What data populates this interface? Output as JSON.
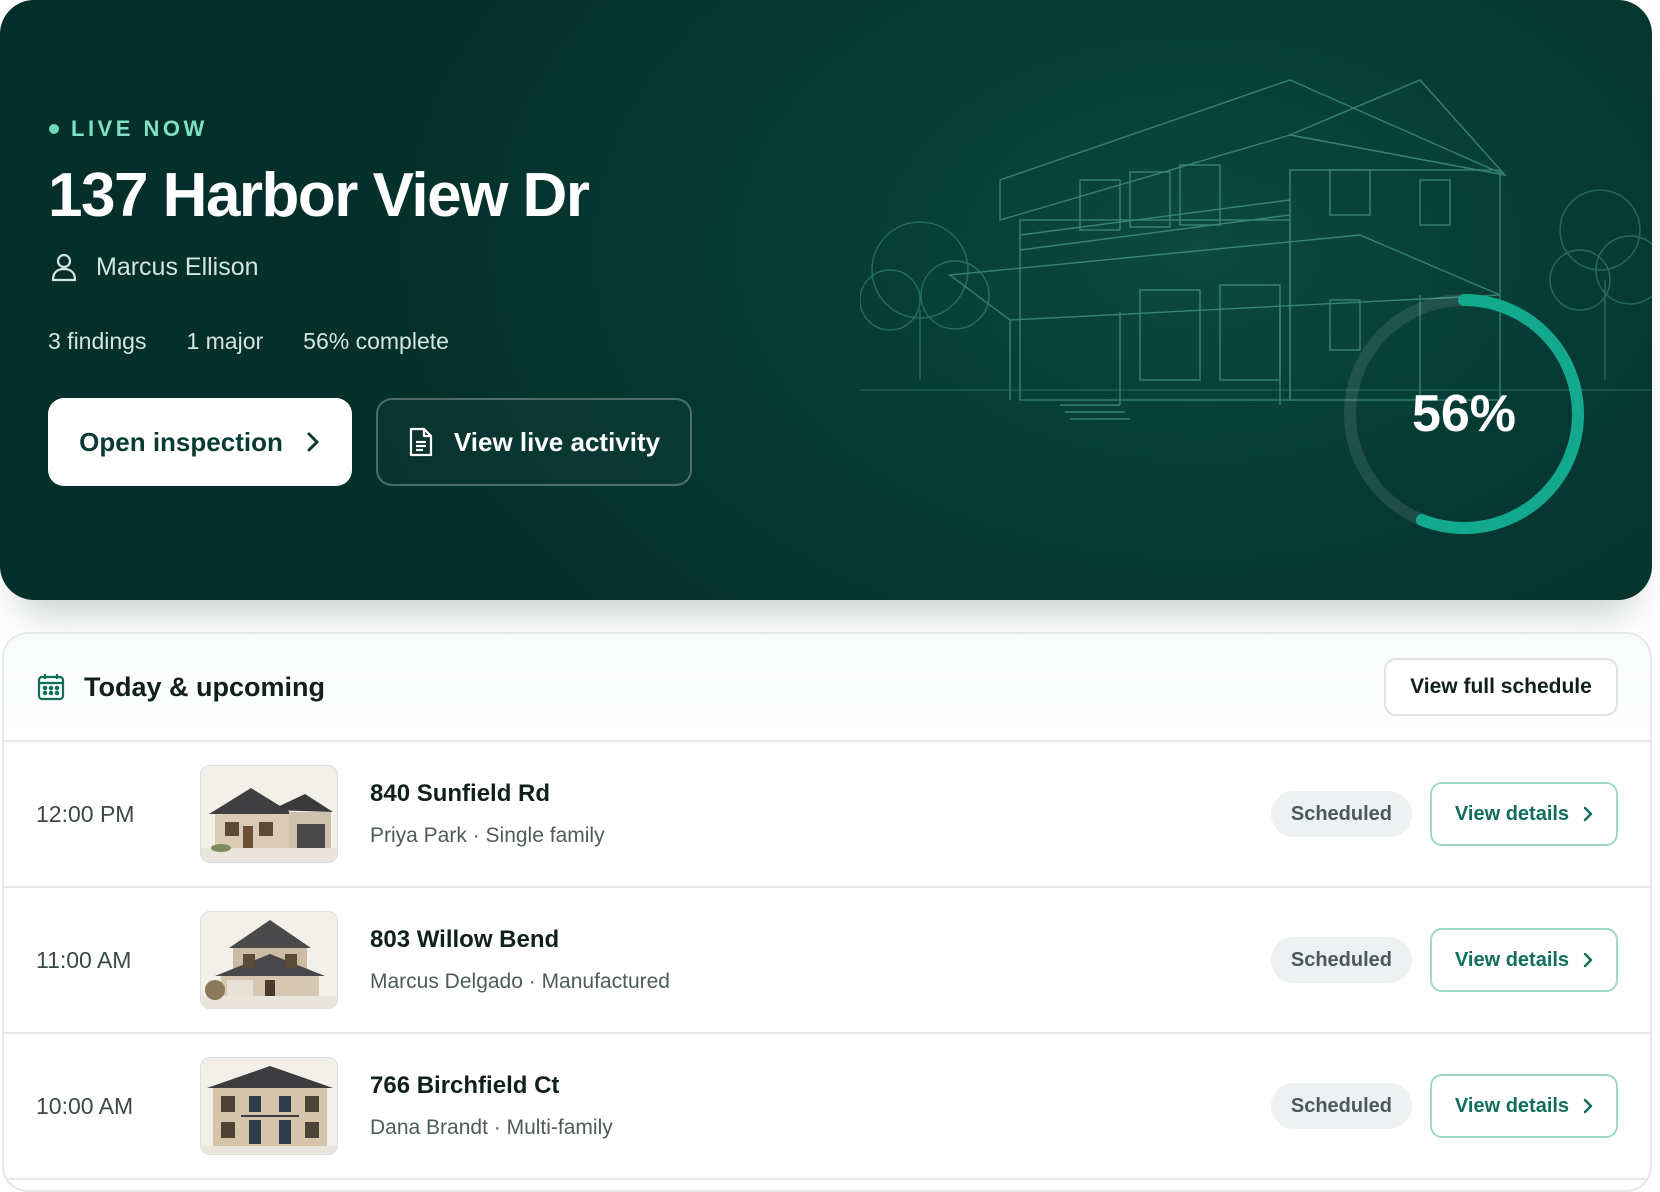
{
  "hero": {
    "live_label": "LIVE NOW",
    "address": "137 Harbor View Dr",
    "inspector": "Marcus Ellison",
    "stats": {
      "findings": "3 findings",
      "major": "1 major",
      "complete": "56% complete"
    },
    "open_button": "Open inspection",
    "activity_button": "View live activity",
    "progress_label": "56%",
    "progress_fraction": 0.56,
    "colors": {
      "accent": "#13a98f",
      "background": "#063a33"
    }
  },
  "schedule": {
    "title": "Today & upcoming",
    "full_schedule_button": "View full schedule",
    "rows": [
      {
        "time": "12:00 PM",
        "address": "840 Sunfield Rd",
        "meta": "Priya Park · Single family",
        "status": "Scheduled",
        "action": "View details"
      },
      {
        "time": "11:00 AM",
        "address": "803 Willow Bend",
        "meta": "Marcus Delgado · Manufactured",
        "status": "Scheduled",
        "action": "View details"
      },
      {
        "time": "10:00 AM",
        "address": "766 Birchfield Ct",
        "meta": "Dana Brandt · Multi-family",
        "status": "Scheduled",
        "action": "View details"
      }
    ]
  }
}
